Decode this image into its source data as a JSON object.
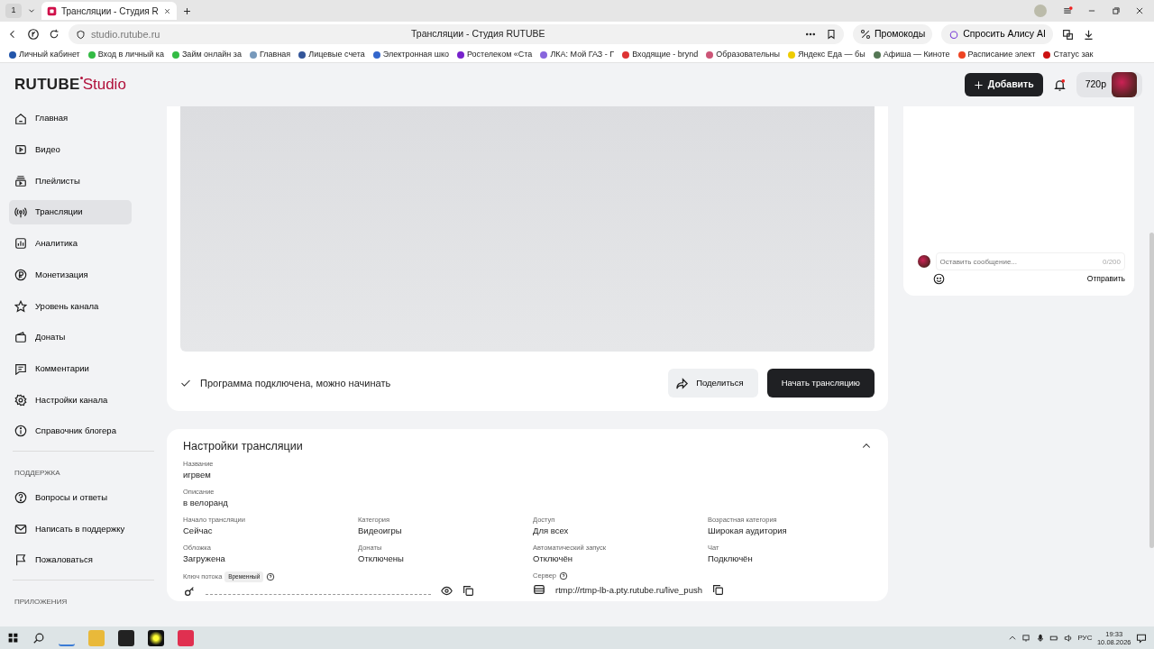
{
  "browser": {
    "tab_counter": "1",
    "tabs": [
      {
        "title": "Трансляции - Студия R",
        "selected": true
      }
    ],
    "url": "studio.rutube.ru",
    "page_title": "Трансляции - Студия RUTUBE",
    "toolbar_buttons": [
      "Промокоды",
      "Спросить Алису AI"
    ],
    "bookmarks": [
      {
        "label": "Личный кабинет",
        "color": "#2255aa"
      },
      {
        "label": "Вход в личный ка",
        "color": "#33bb44"
      },
      {
        "label": "Займ онлайн за",
        "color": "#33bb44"
      },
      {
        "label": "Главная",
        "color": "#7799bb"
      },
      {
        "label": "Лицевые счета",
        "color": "#335599"
      },
      {
        "label": "Электронная шко",
        "color": "#3366cc"
      },
      {
        "label": "Ростелеком «Ста",
        "color": "#7722cc"
      },
      {
        "label": "ЛКА: Мой ГАЗ - Г",
        "color": "#8866dd"
      },
      {
        "label": "Входящие - brynd",
        "color": "#dd3333"
      },
      {
        "label": "Образовательны",
        "color": "#cc5577"
      },
      {
        "label": "Яндекс Еда — бы",
        "color": "#eecc00"
      },
      {
        "label": "Афиша — Киноте",
        "color": "#557755"
      },
      {
        "label": "Расписание элект",
        "color": "#ee4422"
      },
      {
        "label": "Статус зак",
        "color": "#cc1111"
      }
    ]
  },
  "app": {
    "logo": {
      "brand": "RUTUBE",
      "product": "Studio"
    },
    "add_button": "Добавить",
    "notifications_unread": true,
    "quality": "720p"
  },
  "sidebar": {
    "items": [
      {
        "label": "Главная",
        "selected": false
      },
      {
        "label": "Видео",
        "selected": false
      },
      {
        "label": "Плейлисты",
        "selected": false
      },
      {
        "label": "Трансляции",
        "selected": true
      },
      {
        "label": "Аналитика",
        "selected": false
      },
      {
        "label": "Монетизация",
        "selected": false
      },
      {
        "label": "Уровень канала",
        "selected": false
      },
      {
        "label": "Донаты",
        "selected": false
      },
      {
        "label": "Комментарии",
        "selected": false
      },
      {
        "label": "Настройки канала",
        "selected": false
      },
      {
        "label": "Справочник блогера",
        "selected": false
      }
    ],
    "sections": [
      {
        "heading": "ПОДДЕРЖКА",
        "items": [
          {
            "label": "Вопросы и ответы",
            "selected": false
          },
          {
            "label": "Написать в поддержку",
            "selected": false
          },
          {
            "label": "Пожаловаться",
            "selected": false
          }
        ]
      },
      {
        "heading": "ПРИЛОЖЕНИЯ"
      }
    ]
  },
  "stream": {
    "status": "Программа подключена, можно начинать",
    "share_button": "Поделиться",
    "start_button": "Начать трансляцию"
  },
  "settings": {
    "title": "Настройки трансляции",
    "expanded": true,
    "fields": [
      {
        "label": "Название",
        "value": "игрвем"
      },
      {
        "label": "Описание",
        "value": "в велоранд"
      }
    ],
    "grid": [
      {
        "label": "Начало трансляции",
        "value": "Сейчас"
      },
      {
        "label": "Категория",
        "value": "Видеоигры"
      },
      {
        "label": "Доступ",
        "value": "Для всех"
      },
      {
        "label": "Возрастная категория",
        "value": "Широкая аудитория"
      },
      {
        "label": "Обложка",
        "value": "Загружена"
      },
      {
        "label": "Донаты",
        "value": "Отключены"
      },
      {
        "label": "Автоматический запуск",
        "value": "Отключён"
      },
      {
        "label": "Чат",
        "value": "Подключён"
      }
    ],
    "stream_key": {
      "label": "Ключ потока",
      "badge": "Временный"
    },
    "server": {
      "label": "Сервер",
      "value": "rtmp://rtmp-lb-a.pty.rutube.ru/live_push"
    }
  },
  "chat": {
    "placeholder": "Оставить сообщение...",
    "counter": "0/200",
    "send_button": "Отправить"
  },
  "taskbar": {
    "language": "РУС",
    "time": "19:33",
    "date": "10.08.2026"
  }
}
